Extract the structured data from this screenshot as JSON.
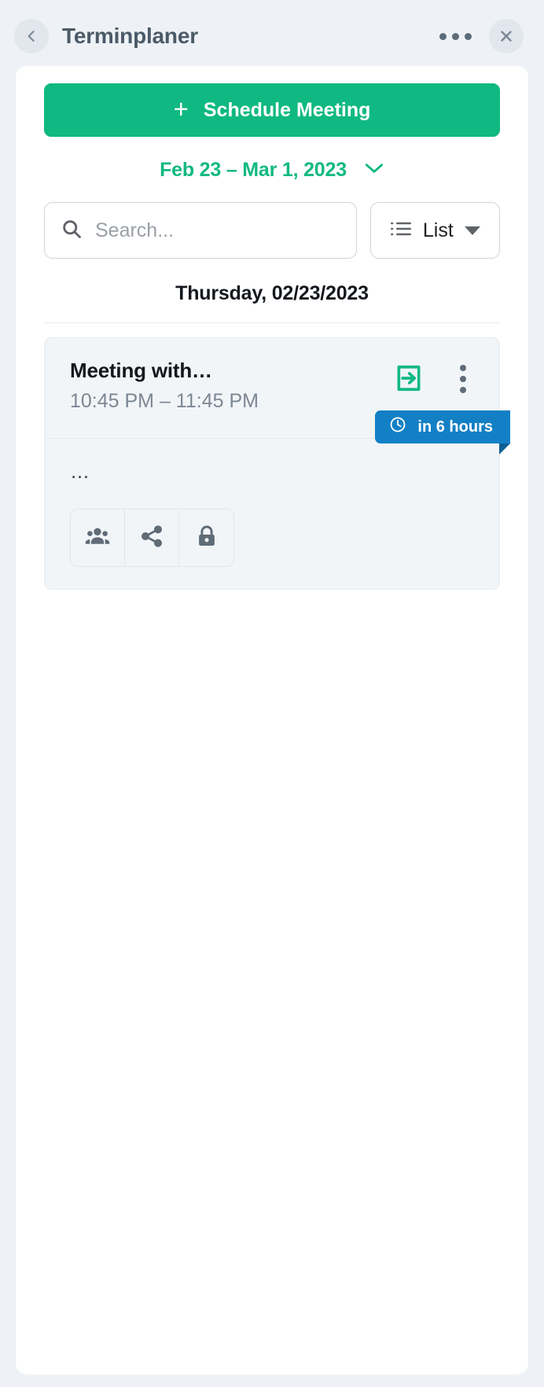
{
  "window": {
    "title": "Terminplaner",
    "back_icon": "chevron-left-icon",
    "overflow_icon": "ellipsis-icon",
    "close_icon": "close-icon"
  },
  "toolbar": {
    "schedule_label": "Schedule Meeting",
    "schedule_plus": "+",
    "accent_color": "#10b981"
  },
  "daterange": {
    "label": "Feb 23 – Mar 1, 2023",
    "caret_icon": "chevron-down-icon"
  },
  "search": {
    "placeholder": "Search...",
    "value": "",
    "icon": "search-icon"
  },
  "view": {
    "label": "List",
    "icon": "list-icon",
    "caret_icon": "caret-down-icon",
    "options": [
      "List"
    ]
  },
  "day": {
    "header": "Thursday, 02/23/2023"
  },
  "event": {
    "title": "Meeting with…",
    "time": "10:45 PM – 11:45 PM",
    "description": "…",
    "join_icon": "login-arrow-icon",
    "kebab_icon": "more-vertical-icon",
    "badge": {
      "text": "in 6 hours",
      "icon": "clock-icon",
      "color": "#1380c6"
    },
    "actions": [
      {
        "name": "participants",
        "icon": "people-icon"
      },
      {
        "name": "share",
        "icon": "share-icon"
      },
      {
        "name": "lock",
        "icon": "lock-icon"
      }
    ]
  }
}
